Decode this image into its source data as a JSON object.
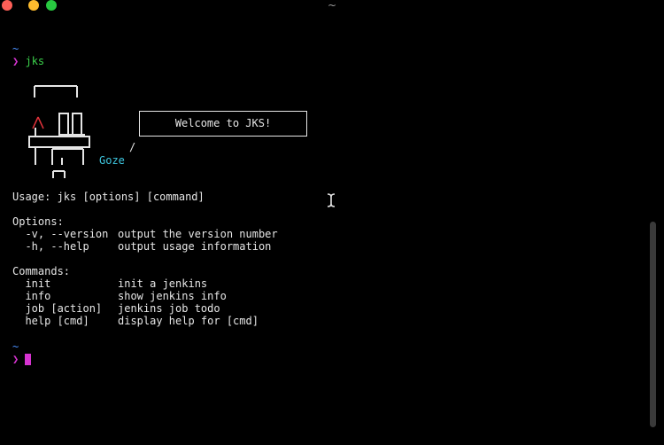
{
  "window": {
    "title": "~"
  },
  "terminal": {
    "prompt_dir_1": "~",
    "prompt_symbol_1": "❯",
    "command": "jks",
    "banner": {
      "welcome_text": "Welcome to JKS!",
      "author": "Goze",
      "slash": "/"
    },
    "usage": "Usage: jks [options] [command]",
    "options_header": "Options:",
    "options": [
      {
        "flag": "  -v, --version",
        "desc": "output the version number"
      },
      {
        "flag": "  -h, --help",
        "desc": "output usage information"
      }
    ],
    "commands_header": "Commands:",
    "commands": [
      {
        "name": "  init",
        "desc": "init a jenkins"
      },
      {
        "name": "  info",
        "desc": "show jenkins info"
      },
      {
        "name": "  job [action]",
        "desc": "jenkins job todo"
      },
      {
        "name": "  help [cmd]",
        "desc": "display help for [cmd]"
      }
    ],
    "prompt_dir_2": "~",
    "prompt_symbol_2": "❯"
  },
  "colors": {
    "background": "#000000",
    "text": "#e6e6e6",
    "prompt_dir": "#4a90ff",
    "prompt_symbol": "#d633d0",
    "command": "#3bd14b",
    "author": "#3ec7e0",
    "cursor": "#d633d0"
  },
  "icons": [
    "traffic-light-close",
    "traffic-light-minimize",
    "traffic-light-zoom",
    "text-cursor-ibeam-icon"
  ]
}
